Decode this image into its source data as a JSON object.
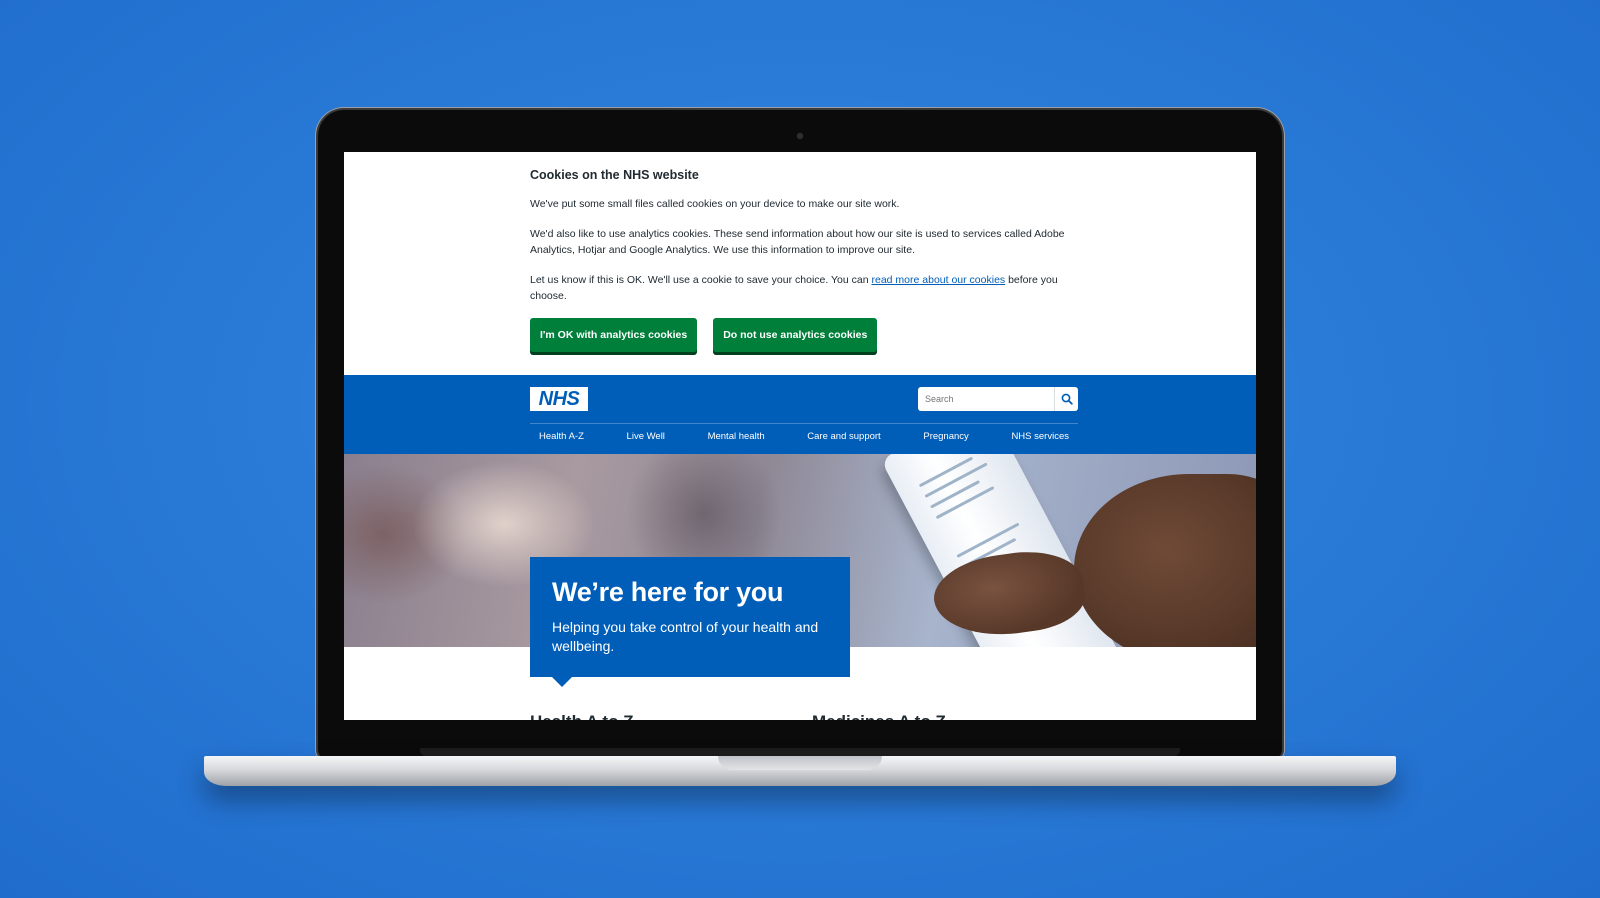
{
  "cookie_banner": {
    "title": "Cookies on the NHS website",
    "para1": "We've put some small files called cookies on your device to make our site work.",
    "para2": "We'd also like to use analytics cookies. These send information about how our site is used to services called Adobe Analytics, Hotjar and Google Analytics. We use this information to improve our site.",
    "para3_before": "Let us know if this is OK. We'll use a cookie to save your choice. You can ",
    "para3_link": "read more about our cookies",
    "para3_after": " before you choose.",
    "accept_button": "I'm OK with analytics cookies",
    "reject_button": "Do not use analytics cookies"
  },
  "header": {
    "logo_text": "NHS",
    "search_placeholder": "Search",
    "nav": [
      "Health A-Z",
      "Live Well",
      "Mental health",
      "Care and support",
      "Pregnancy",
      "NHS services"
    ]
  },
  "hero": {
    "title": "We’re here for you",
    "subtitle": "Helping you take control of your health and wellbeing."
  },
  "sections": {
    "left_heading": "Health A to Z",
    "right_heading": "Medicines A to Z"
  },
  "colors": {
    "nhs_blue": "#005eb8",
    "button_green": "#007f3b",
    "background_blue": "#2a7bd8"
  }
}
